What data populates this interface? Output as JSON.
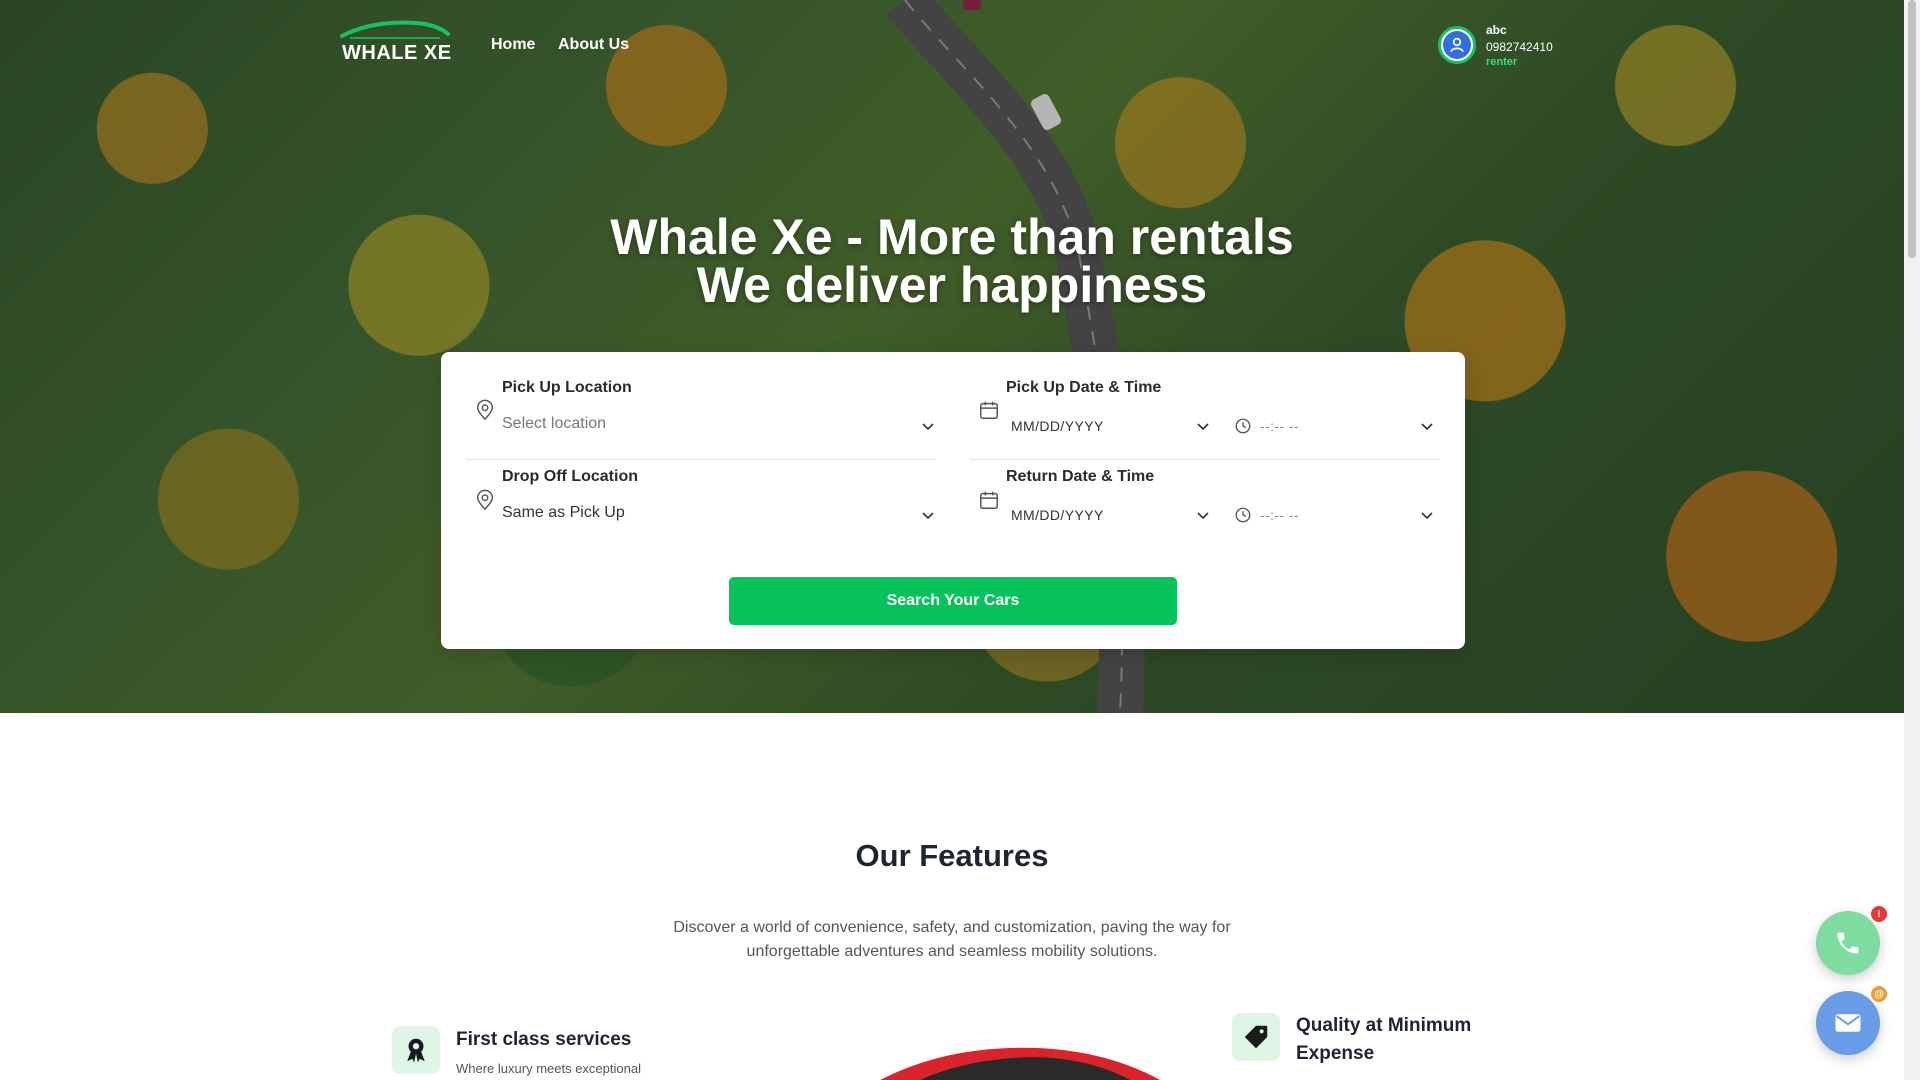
{
  "nav": {
    "logo_text": "WHALE XE",
    "links": [
      {
        "label": "Home"
      },
      {
        "label": "About Us"
      }
    ]
  },
  "user": {
    "name": "abc",
    "phone": "0982742410",
    "role": "renter"
  },
  "hero": {
    "title_line1": "Whale Xe - More than rentals",
    "title_line2": "We deliver happiness"
  },
  "search": {
    "pickup_location": {
      "label": "Pick Up Location",
      "value": "Select location"
    },
    "dropoff_location": {
      "label": "Drop Off Location",
      "value": "Same as Pick Up"
    },
    "pickup_datetime": {
      "label": "Pick Up Date & Time",
      "date": "MM/DD/YYYY",
      "time": "--:-- --"
    },
    "return_datetime": {
      "label": "Return Date & Time",
      "date": "MM/DD/YYYY",
      "time": "--:-- --"
    },
    "button_label": "Search Your Cars"
  },
  "features": {
    "title": "Our Features",
    "description_line1": "Discover a world of convenience, safety, and customization, paving the way for",
    "description_line2": "unforgettable adventures and seamless mobility solutions.",
    "items": [
      {
        "title": "First class services",
        "subtitle": "Where luxury meets exceptional"
      },
      {
        "title_line1": "Quality at Minimum",
        "title_line2": "Expense"
      }
    ]
  },
  "floating": {
    "phone_badge": "!",
    "mail_badge": "@"
  },
  "colors": {
    "brand_green": "#06c25a",
    "text_dark": "#1d2433",
    "avatar_blue": "#2f6fe0",
    "phone_button": "#7fdca0",
    "mail_button": "#6a9de8",
    "badge_red": "#e53935",
    "badge_orange": "#f39c33"
  },
  "icons": [
    "map-pin-icon",
    "calendar-icon",
    "clock-icon",
    "chevron-down-icon",
    "user-icon",
    "award-icon",
    "tag-icon",
    "phone-icon",
    "mail-icon"
  ]
}
